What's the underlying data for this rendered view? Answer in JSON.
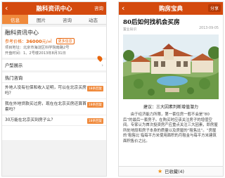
{
  "left": {
    "nav": {
      "back": "‹",
      "title": "融科资讯中心",
      "button": "咨询"
    },
    "tabs": [
      "信息",
      "图片",
      "咨询",
      "动态"
    ],
    "project": {
      "name": "融科资讯中心",
      "price_label": "参考价格：",
      "price_value": "36000",
      "price_unit": "元/㎡",
      "more_button": "更多信息",
      "address": "项目地址：北京市海淀区科学院南路2号",
      "opening": "开盘时间：1、2号楼2013年8月31日"
    },
    "layout_section": {
      "title": "户型展示"
    },
    "faq": {
      "title": "热门咨询",
      "items": [
        {
          "text": "外地人没有社保和收入证明，可以在北京买房吗？",
          "badge": "18条回复"
        },
        {
          "text": "我在外地贷款买过房，现在在北京买房还算首套吗？",
          "badge": "18条回复"
        },
        {
          "text": "30万能在北京买到房子么？",
          "badge": "18条回复"
        }
      ]
    }
  },
  "right": {
    "nav": {
      "back": "‹",
      "title": "购房宝典",
      "share": "分享"
    },
    "article": {
      "title": "80后如何找机会买房",
      "source": "置业知识",
      "date": "2013-09-05",
      "caption": "建议：三大因素判断增值潜力",
      "body": "由于经济能力所限，第一套住房一般不会是“80后”的最后一套房子。在购买时应该关注房子的增值空间。专家认为首次投资房产应重点关注三大因素，即房屋所处地段和房子本身的质量以及房屋的“租售比”。“房屋的‘租售比’指每平方米使用面积的月租金与每平方米建筑面积售价之比。"
    },
    "favorite": {
      "label": "已收藏(4)"
    }
  },
  "colors": {
    "brand": "#d44a0e",
    "accent": "#f08a3c",
    "price": "#e8650c"
  }
}
